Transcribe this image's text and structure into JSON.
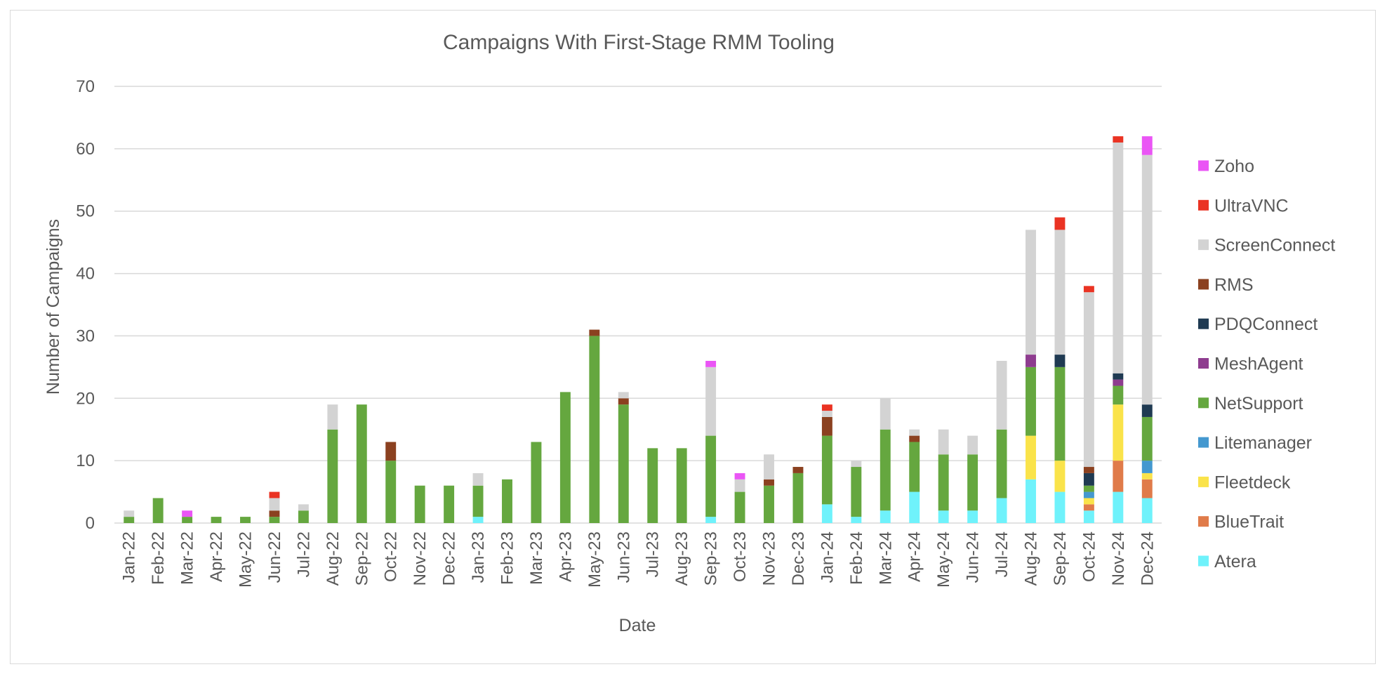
{
  "chart_data": {
    "type": "bar",
    "stacked": true,
    "title": "Campaigns With First-Stage RMM Tooling",
    "xlabel": "Date",
    "ylabel": "Number of Campaigns",
    "ylim": [
      0,
      70
    ],
    "yticks": [
      0,
      10,
      20,
      30,
      40,
      50,
      60,
      70
    ],
    "grid": true,
    "legend_position": "right",
    "categories": [
      "Jan-22",
      "Feb-22",
      "Mar-22",
      "Apr-22",
      "May-22",
      "Jun-22",
      "Jul-22",
      "Aug-22",
      "Sep-22",
      "Oct-22",
      "Nov-22",
      "Dec-22",
      "Jan-23",
      "Feb-23",
      "Mar-23",
      "Apr-23",
      "May-23",
      "Jun-23",
      "Jul-23",
      "Aug-23",
      "Sep-23",
      "Oct-23",
      "Nov-23",
      "Dec-23",
      "Jan-24",
      "Feb-24",
      "Mar-24",
      "Apr-24",
      "May-24",
      "Jun-24",
      "Jul-24",
      "Aug-24",
      "Sep-24",
      "Oct-24",
      "Nov-24",
      "Dec-24"
    ],
    "series": [
      {
        "name": "Atera",
        "color": "#6ff2fb",
        "values": [
          0,
          0,
          0,
          0,
          0,
          0,
          0,
          0,
          0,
          0,
          0,
          0,
          1,
          0,
          0,
          0,
          0,
          0,
          0,
          0,
          1,
          0,
          0,
          0,
          3,
          1,
          2,
          5,
          2,
          2,
          4,
          7,
          5,
          2,
          5,
          4
        ]
      },
      {
        "name": "BlueTrait",
        "color": "#e07b4a",
        "values": [
          0,
          0,
          0,
          0,
          0,
          0,
          0,
          0,
          0,
          0,
          0,
          0,
          0,
          0,
          0,
          0,
          0,
          0,
          0,
          0,
          0,
          0,
          0,
          0,
          0,
          0,
          0,
          0,
          0,
          0,
          0,
          0,
          0,
          1,
          5,
          3
        ]
      },
      {
        "name": "Fleetdeck",
        "color": "#fae34a",
        "values": [
          0,
          0,
          0,
          0,
          0,
          0,
          0,
          0,
          0,
          0,
          0,
          0,
          0,
          0,
          0,
          0,
          0,
          0,
          0,
          0,
          0,
          0,
          0,
          0,
          0,
          0,
          0,
          0,
          0,
          0,
          0,
          7,
          5,
          1,
          9,
          1
        ]
      },
      {
        "name": "Litemanager",
        "color": "#4498cf",
        "values": [
          0,
          0,
          0,
          0,
          0,
          0,
          0,
          0,
          0,
          0,
          0,
          0,
          0,
          0,
          0,
          0,
          0,
          0,
          0,
          0,
          0,
          0,
          0,
          0,
          0,
          0,
          0,
          0,
          0,
          0,
          0,
          0,
          0,
          1,
          0,
          2
        ]
      },
      {
        "name": "NetSupport",
        "color": "#65a73f",
        "values": [
          1,
          4,
          1,
          1,
          1,
          1,
          2,
          15,
          19,
          10,
          6,
          6,
          5,
          7,
          13,
          21,
          30,
          19,
          12,
          12,
          13,
          5,
          6,
          8,
          11,
          8,
          13,
          8,
          9,
          9,
          11,
          11,
          15,
          1,
          3,
          7
        ]
      },
      {
        "name": "MeshAgent",
        "color": "#8e3c8f",
        "values": [
          0,
          0,
          0,
          0,
          0,
          0,
          0,
          0,
          0,
          0,
          0,
          0,
          0,
          0,
          0,
          0,
          0,
          0,
          0,
          0,
          0,
          0,
          0,
          0,
          0,
          0,
          0,
          0,
          0,
          0,
          0,
          2,
          0,
          0,
          1,
          0
        ]
      },
      {
        "name": "PDQConnect",
        "color": "#1f3a52",
        "values": [
          0,
          0,
          0,
          0,
          0,
          0,
          0,
          0,
          0,
          0,
          0,
          0,
          0,
          0,
          0,
          0,
          0,
          0,
          0,
          0,
          0,
          0,
          0,
          0,
          0,
          0,
          0,
          0,
          0,
          0,
          0,
          0,
          2,
          2,
          1,
          2
        ]
      },
      {
        "name": "RMS",
        "color": "#8b4120",
        "values": [
          0,
          0,
          0,
          0,
          0,
          1,
          0,
          0,
          0,
          3,
          0,
          0,
          0,
          0,
          0,
          0,
          1,
          1,
          0,
          0,
          0,
          0,
          1,
          1,
          3,
          0,
          0,
          1,
          0,
          0,
          0,
          0,
          0,
          1,
          0,
          0
        ]
      },
      {
        "name": "ScreenConnect",
        "color": "#d3d3d3",
        "values": [
          1,
          0,
          0,
          0,
          0,
          2,
          1,
          4,
          0,
          0,
          0,
          0,
          2,
          0,
          0,
          0,
          0,
          1,
          0,
          0,
          11,
          2,
          4,
          0,
          1,
          1,
          5,
          1,
          4,
          3,
          11,
          20,
          20,
          28,
          37,
          40
        ]
      },
      {
        "name": "UltraVNC",
        "color": "#ea3323",
        "values": [
          0,
          0,
          0,
          0,
          0,
          1,
          0,
          0,
          0,
          0,
          0,
          0,
          0,
          0,
          0,
          0,
          0,
          0,
          0,
          0,
          0,
          0,
          0,
          0,
          1,
          0,
          0,
          0,
          0,
          0,
          0,
          0,
          2,
          1,
          1,
          0
        ]
      },
      {
        "name": "Zoho",
        "color": "#ea55f5",
        "values": [
          0,
          0,
          1,
          0,
          0,
          0,
          0,
          0,
          0,
          0,
          0,
          0,
          0,
          0,
          0,
          0,
          0,
          0,
          0,
          0,
          1,
          1,
          0,
          0,
          0,
          0,
          0,
          0,
          0,
          0,
          0,
          0,
          0,
          0,
          0,
          3
        ]
      }
    ]
  }
}
